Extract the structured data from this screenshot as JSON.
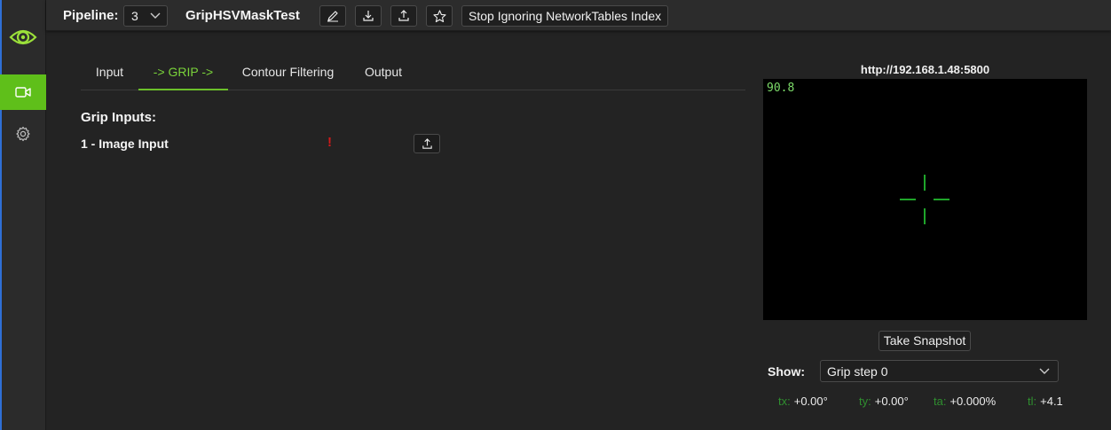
{
  "topbar": {
    "pipeline_label": "Pipeline:",
    "pipeline_index": "3",
    "pipeline_name": "GripHSVMaskTest",
    "stop_ignoring_label": "Stop Ignoring NetworkTables Index"
  },
  "tabs": [
    {
      "label": "Input"
    },
    {
      "label": "-> GRIP ->"
    },
    {
      "label": "Contour Filtering"
    },
    {
      "label": "Output"
    }
  ],
  "grip": {
    "title": "Grip Inputs:",
    "inputs": [
      {
        "label": "1 - Image Input",
        "status_mark": "!"
      }
    ]
  },
  "stream": {
    "url": "http://192.168.1.48:5800",
    "fps": "90.8",
    "snapshot_label": "Take Snapshot"
  },
  "show": {
    "label": "Show:",
    "value": "Grip step 0"
  },
  "stats": {
    "tx": {
      "key": "tx:",
      "value": "+0.00°"
    },
    "ty": {
      "key": "ty:",
      "value": "+0.00°"
    },
    "ta": {
      "key": "ta:",
      "value": "+0.000%"
    },
    "tl": {
      "key": "tl:",
      "value": "+4.1"
    }
  },
  "colors": {
    "accent": "#5fbf1a",
    "active_tab": "#7ad33a",
    "warning": "#d11a1a",
    "crosshair": "#1fa52a"
  },
  "icons": {
    "logo": "limelight-logo-icon",
    "camera": "camera-icon",
    "settings": "gear-icon",
    "edit": "pencil-icon",
    "download": "download-icon",
    "upload": "upload-icon",
    "star": "star-icon",
    "dropdown": "chevron-down-icon"
  }
}
